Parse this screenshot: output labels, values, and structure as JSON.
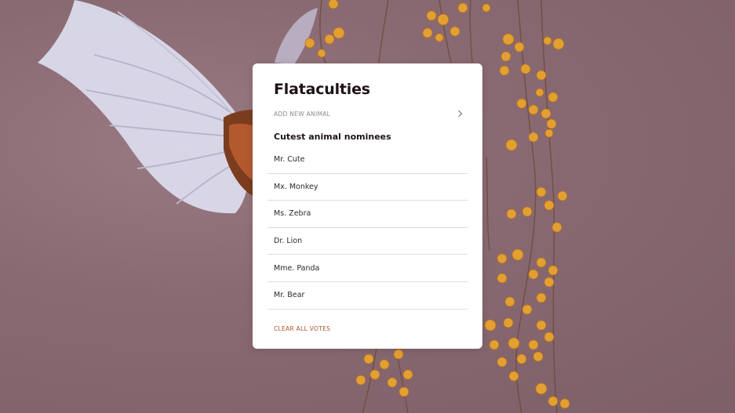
{
  "app": {
    "title": "Flataculties"
  },
  "add_animal": {
    "label": "ADD NEW ANIMAL"
  },
  "nominees": {
    "heading": "Cutest animal nominees",
    "items": [
      {
        "name": "Mr. Cute"
      },
      {
        "name": "Mx. Monkey"
      },
      {
        "name": "Ms. Zebra"
      },
      {
        "name": "Dr. Lion"
      },
      {
        "name": "Mme. Panda"
      },
      {
        "name": "Mr. Bear"
      }
    ]
  },
  "actions": {
    "clear_votes": "CLEAR ALL VOTES"
  },
  "colors": {
    "accent": "#a8552a",
    "title": "#1e1416",
    "card": "#ffffff",
    "background": "#8a6a72"
  },
  "icons": {
    "add_chevron": "chevron-right-icon"
  }
}
